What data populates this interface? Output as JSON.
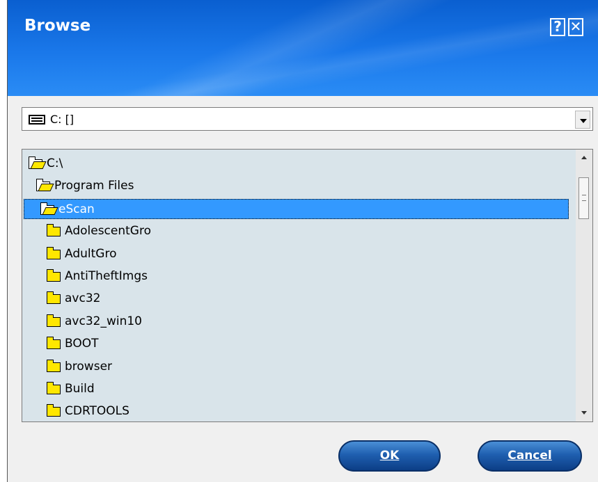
{
  "window": {
    "title": "Browse",
    "help_label": "?",
    "close_label": "✕"
  },
  "drive_select": {
    "value": "C: []",
    "icon": "drive-icon"
  },
  "tree": {
    "items": [
      {
        "label": "C:\\",
        "icon": "folder-open-icon",
        "indent": 0,
        "selected": false
      },
      {
        "label": "Program Files",
        "icon": "folder-open-icon",
        "indent": 1,
        "selected": false
      },
      {
        "label": "eScan",
        "icon": "folder-open-icon",
        "indent": 2,
        "selected": true
      },
      {
        "label": "AdolescentGro",
        "icon": "folder-icon",
        "indent": 3,
        "selected": false
      },
      {
        "label": "AdultGro",
        "icon": "folder-icon",
        "indent": 3,
        "selected": false
      },
      {
        "label": "AntiTheftImgs",
        "icon": "folder-icon",
        "indent": 3,
        "selected": false
      },
      {
        "label": "avc32",
        "icon": "folder-icon",
        "indent": 3,
        "selected": false
      },
      {
        "label": "avc32_win10",
        "icon": "folder-icon",
        "indent": 3,
        "selected": false
      },
      {
        "label": "BOOT",
        "icon": "folder-icon",
        "indent": 3,
        "selected": false
      },
      {
        "label": "browser",
        "icon": "folder-icon",
        "indent": 3,
        "selected": false
      },
      {
        "label": "Build",
        "icon": "folder-icon",
        "indent": 3,
        "selected": false
      },
      {
        "label": "CDRTOOLS",
        "icon": "folder-icon",
        "indent": 3,
        "selected": false
      }
    ]
  },
  "buttons": {
    "ok_label": "OK",
    "cancel_label": "Cancel"
  },
  "colors": {
    "title_bar": "#1a78ea",
    "selection": "#3399ff",
    "tree_background": "#d9e4ea",
    "folder_yellow": "#ffe700",
    "button_blue": "#1f5fb0"
  }
}
